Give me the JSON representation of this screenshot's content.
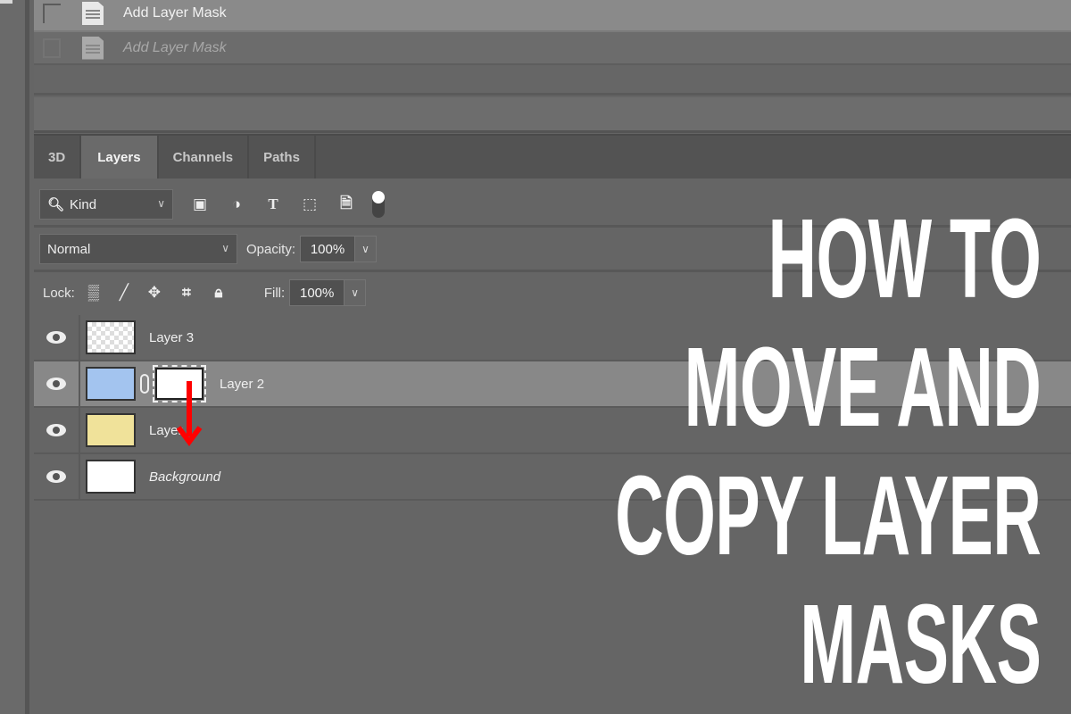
{
  "history": {
    "items": [
      {
        "label": "Add Layer Mask",
        "state": "active",
        "icon": "document-icon"
      },
      {
        "label": "Add Layer Mask",
        "state": "undone",
        "icon": "document-icon"
      }
    ]
  },
  "panel": {
    "tabs": [
      {
        "label": "3D",
        "active": false
      },
      {
        "label": "Layers",
        "active": true
      },
      {
        "label": "Channels",
        "active": false
      },
      {
        "label": "Paths",
        "active": false
      }
    ],
    "filter": {
      "kind_label": "Kind",
      "icons": [
        "pixel-layer-filter-icon",
        "adjustment-layer-filter-icon",
        "type-layer-filter-icon",
        "shape-layer-filter-icon",
        "smart-object-filter-icon",
        "filter-toggle-icon"
      ]
    },
    "blend_mode": "Normal",
    "opacity_label": "Opacity:",
    "opacity_value": "100%",
    "lock_label": "Lock:",
    "lock_icons": [
      "lock-transparent-pixels-icon",
      "lock-image-pixels-icon",
      "lock-position-icon",
      "lock-artboard-icon",
      "lock-all-icon"
    ],
    "fill_label": "Fill:",
    "fill_value": "100%"
  },
  "layers": [
    {
      "name": "Layer 3",
      "visible": true,
      "thumb": "transparent",
      "has_mask": false,
      "selected": false,
      "italic": false
    },
    {
      "name": "Layer 2",
      "visible": true,
      "thumb": "#a3c4ef",
      "has_mask": true,
      "mask_color": "#ffffff",
      "selected": true,
      "italic": false
    },
    {
      "name": "Layer 1",
      "visible": true,
      "thumb": "#f0e29a",
      "has_mask": false,
      "selected": false,
      "italic": false
    },
    {
      "name": "Background",
      "visible": true,
      "thumb": "#ffffff",
      "has_mask": false,
      "selected": false,
      "italic": true
    }
  ],
  "annotation": {
    "arrow_color": "#ff0000",
    "meaning": "drag mask from Layer 2 down to Layer 1"
  },
  "headline": {
    "lines": [
      "HOW TO",
      "MOVE AND",
      "COPY LAYER",
      "MASKS"
    ],
    "color": "#ffffff"
  }
}
